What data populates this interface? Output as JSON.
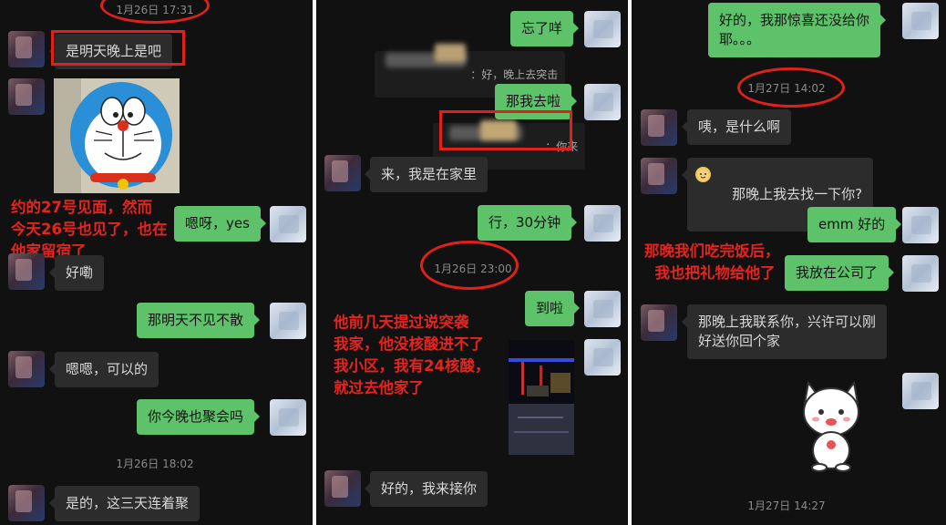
{
  "panel1": {
    "timestamp_top": "1月26日 17:31",
    "msg_confirm_tonight": "是明天晚上是吧",
    "msg_yes": "嗯呀，yes",
    "msg_ok_1": "好嘞",
    "msg_see_tomorrow": "那明天不见不散",
    "msg_ok_2": "嗯嗯，可以的",
    "msg_party_tonight": "你今晚也聚会吗",
    "timestamp_mid": "1月26日 18:02",
    "msg_three_days": "是的，这三天连着聚",
    "annotation": "约的27号见面，然而\n今天26号也见了，也在\n他家留宿了",
    "sticker_name": "doraemon-sticker"
  },
  "panel2": {
    "msg_forgot": "忘了咩",
    "sys_reply_1": "：好，晚上去突击",
    "msg_then_go": "那我去啦",
    "sys_reply_2": "：你来",
    "msg_at_home": "来，我是在家里",
    "msg_thirty_min": "行，30分钟",
    "timestamp": "1月26日 23:00",
    "msg_arrived": "到啦",
    "msg_pickup": "好的，我来接你",
    "annotation": "他前几天提过说突袭\n我家，他没核酸进不了\n我小区，我有24核酸，\n就过去他家了"
  },
  "panel3": {
    "msg_surprise": "好的，我那惊喜还没给你\n耶。。。",
    "timestamp_top": "1月27日 14:02",
    "msg_what": "咦，是什么啊",
    "msg_find_you": "那晚上我去找一下你?",
    "msg_emm_ok": "emm 好的",
    "msg_at_company": "我放在公司了",
    "msg_contact": "那晚上我联系你，兴许可以刚\n好送你回个家",
    "timestamp_bottom": "1月27日 14:27",
    "annotation": "那晚我们吃完饭后，\n  我也把礼物给他了",
    "sticker_name": "white-cat-sticker"
  },
  "colors": {
    "accent_red": "#e0211b",
    "bubble_green": "#5ec26a",
    "bubble_dark": "#2c2c2c"
  }
}
